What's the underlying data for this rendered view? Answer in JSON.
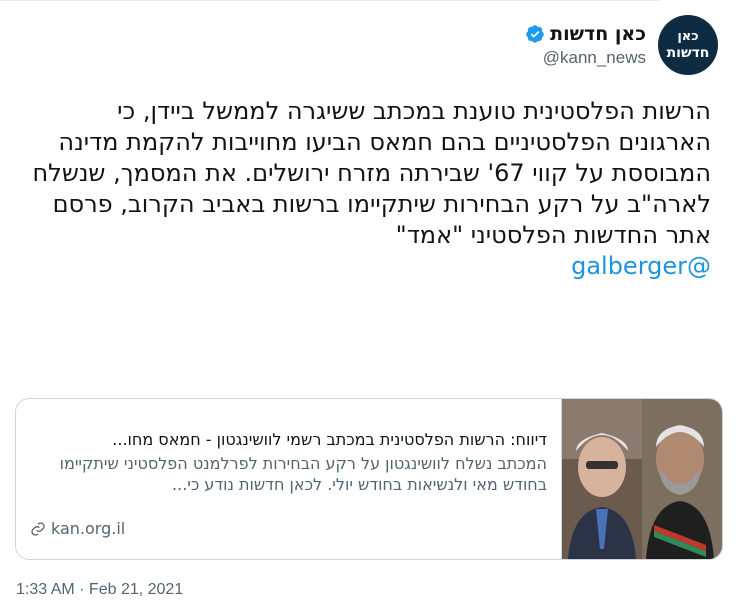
{
  "account": {
    "display_name": "כאן חדשות",
    "handle": "@kann_news",
    "avatar_line1": "כאן",
    "avatar_line2": "חדשות"
  },
  "tweet": {
    "text": "הרשות הפלסטינית טוענת במכתב ששיגרה לממשל ביידן, כי הארגונים הפלסטיניים בהם חמאס הביעו מחוייבות להקמת מדינה המבוססת על קווי 67' שבירתה מזרח ירושלים. את המסמך, שנשלח לארה\"ב על רקע הבחירות שיתקיימו ברשות באביב הקרוב, פרסם אתר החדשות הפלסטיני \"אמד\"",
    "mention": "@galberger",
    "timestamp": "1:33 AM · Feb 21, 2021"
  },
  "card": {
    "title": "דיווח: הרשות הפלסטינית במכתב רשמי לוושינגטון - חמאס מחו...",
    "description": "המכתב נשלח לוושינגטון על רקע הבחירות לפרלמנט הפלסטיני שיתקיימו בחודש מאי ולנשיאות בחודש יולי. לכאן חדשות נודע כי...",
    "domain": "kan.org.il"
  },
  "colors": {
    "link": "#1b95e0",
    "verified": "#1d9bf0",
    "avatar_bg": "#0d2c42",
    "secondary_text": "#536471"
  }
}
